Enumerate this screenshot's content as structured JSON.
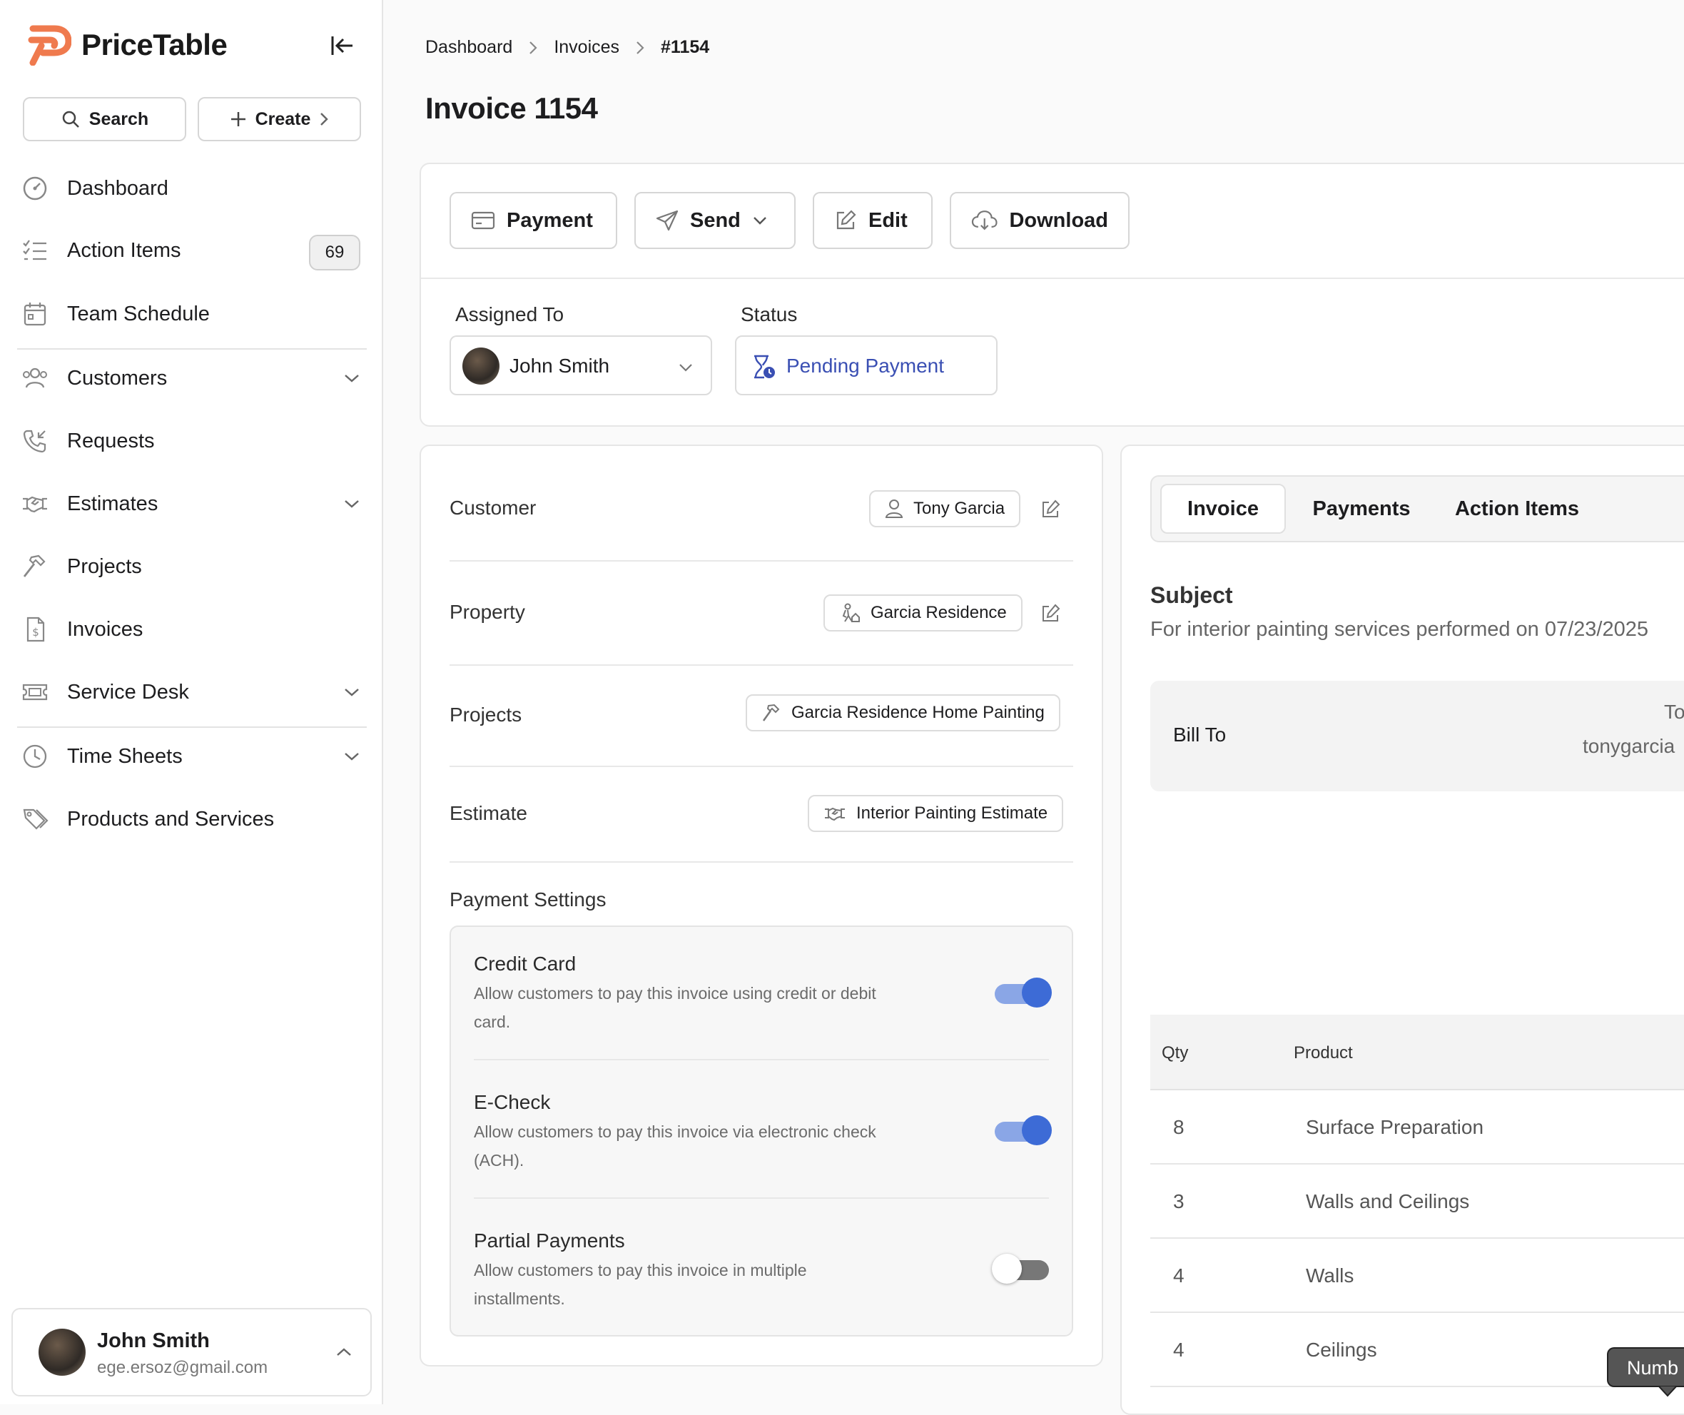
{
  "app": {
    "name": "PriceTable"
  },
  "sidebar": {
    "search_label": "Search",
    "create_label": "Create",
    "items": [
      {
        "label": "Dashboard",
        "icon": "dashboard-gauge-icon"
      },
      {
        "label": "Action Items",
        "icon": "checklist-icon",
        "badge": "69"
      },
      {
        "label": "Team Schedule",
        "icon": "calendar-icon"
      },
      {
        "label": "Customers",
        "icon": "users-icon",
        "expandable": true
      },
      {
        "label": "Requests",
        "icon": "phone-incoming-icon"
      },
      {
        "label": "Estimates",
        "icon": "handshake-icon",
        "expandable": true
      },
      {
        "label": "Projects",
        "icon": "hammer-icon"
      },
      {
        "label": "Invoices",
        "icon": "invoice-dollar-icon"
      },
      {
        "label": "Service Desk",
        "icon": "ticket-icon",
        "expandable": true
      },
      {
        "label": "Time Sheets",
        "icon": "clock-icon",
        "expandable": true
      },
      {
        "label": "Products and Services",
        "icon": "tags-icon"
      }
    ],
    "user": {
      "name": "John Smith",
      "email": "ege.ersoz@gmail.com"
    }
  },
  "breadcrumb": [
    "Dashboard",
    "Invoices",
    "#1154"
  ],
  "page": {
    "title": "Invoice 1154"
  },
  "actions": {
    "payment": "Payment",
    "send": "Send",
    "edit": "Edit",
    "download": "Download"
  },
  "assignment": {
    "assigned_label": "Assigned To",
    "assigned_value": "John Smith",
    "status_label": "Status",
    "status_value": "Pending Payment",
    "status_color": "#3a4fb3"
  },
  "details": {
    "customer_label": "Customer",
    "customer_value": "Tony Garcia",
    "property_label": "Property",
    "property_value": "Garcia Residence",
    "projects_label": "Projects",
    "projects_value": "Garcia Residence Home Painting",
    "estimate_label": "Estimate",
    "estimate_value": "Interior Painting Estimate"
  },
  "payment_settings": {
    "title": "Payment Settings",
    "options": [
      {
        "title": "Credit Card",
        "desc": "Allow customers to pay this invoice using credit or debit card.",
        "enabled": true
      },
      {
        "title": "E-Check",
        "desc": "Allow customers to pay this invoice via electronic check (ACH).",
        "enabled": true
      },
      {
        "title": "Partial Payments",
        "desc": "Allow customers to pay this invoice in multiple installments.",
        "enabled": false
      }
    ]
  },
  "tabs": [
    "Invoice",
    "Payments",
    "Action Items"
  ],
  "invoice": {
    "subject_label": "Subject",
    "subject_value": "For interior painting services performed on 07/23/2025",
    "bill_to_label": "Bill To",
    "bill_to_name": "To",
    "bill_to_email": "tonygarcia",
    "table": {
      "headers": [
        "Qty",
        "Product"
      ],
      "rows": [
        {
          "qty": "8",
          "product": "Surface Preparation"
        },
        {
          "qty": "3",
          "product": "Walls and Ceilings"
        },
        {
          "qty": "4",
          "product": "Walls"
        },
        {
          "qty": "4",
          "product": "Ceilings"
        }
      ]
    },
    "tooltip": "Numb"
  },
  "colors": {
    "accent": "#3d6bd6",
    "brand": "#ef7a4e"
  }
}
